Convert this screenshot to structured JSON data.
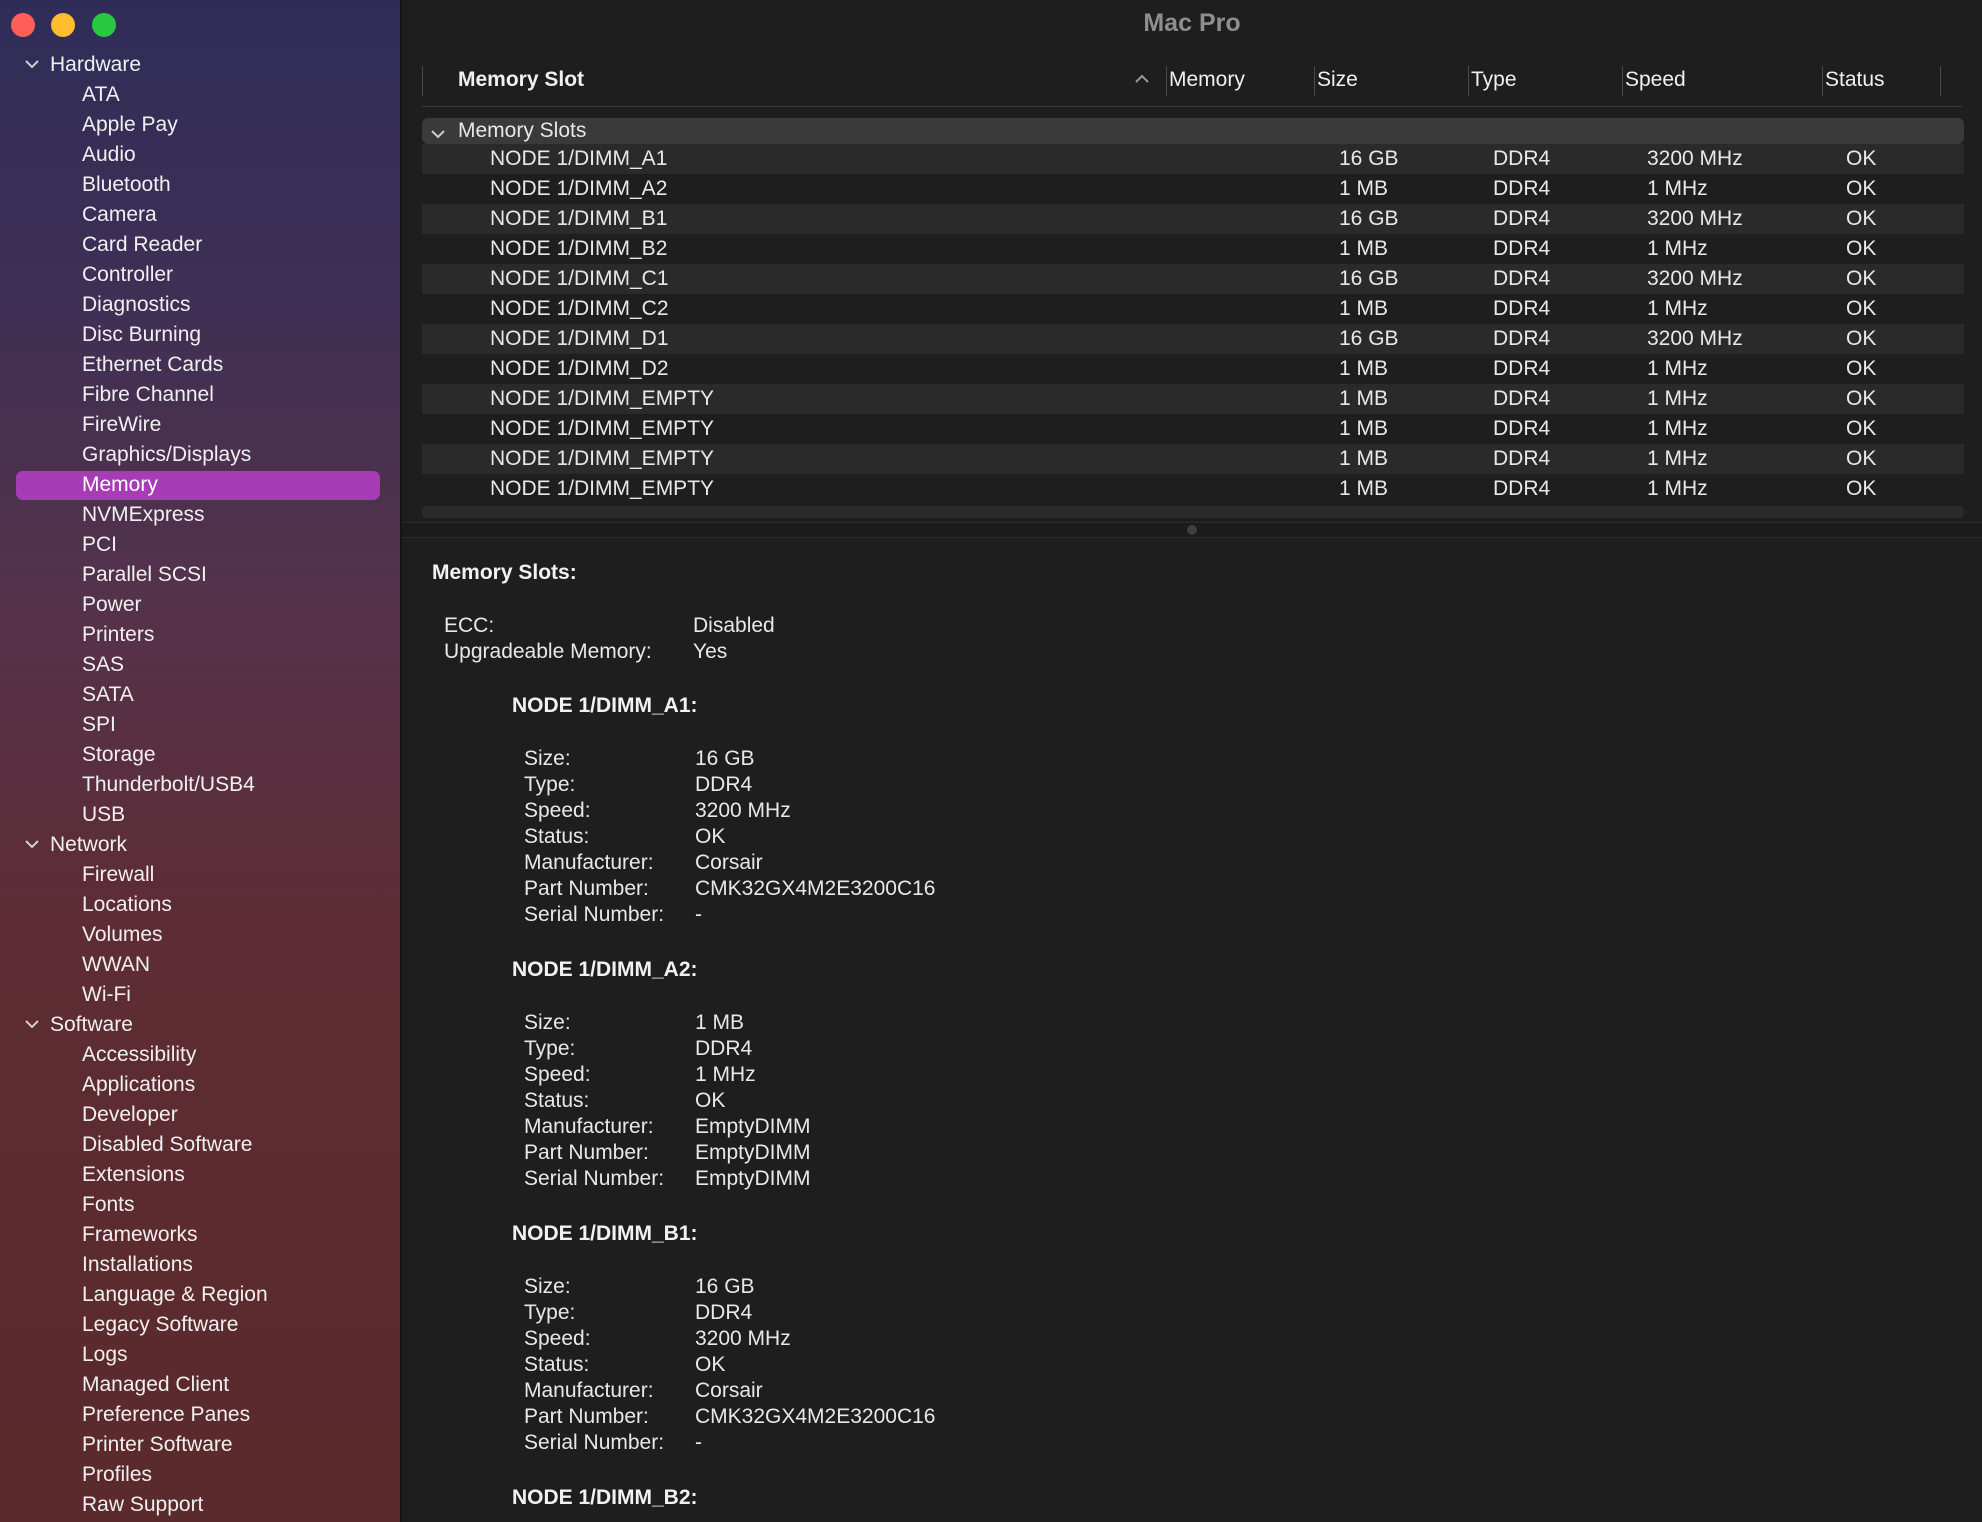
{
  "window": {
    "title": "Mac Pro"
  },
  "sidebar": {
    "groups": [
      {
        "label": "Hardware",
        "items": [
          "ATA",
          "Apple Pay",
          "Audio",
          "Bluetooth",
          "Camera",
          "Card Reader",
          "Controller",
          "Diagnostics",
          "Disc Burning",
          "Ethernet Cards",
          "Fibre Channel",
          "FireWire",
          "Graphics/Displays",
          "Memory",
          "NVMExpress",
          "PCI",
          "Parallel SCSI",
          "Power",
          "Printers",
          "SAS",
          "SATA",
          "SPI",
          "Storage",
          "Thunderbolt/USB4",
          "USB"
        ]
      },
      {
        "label": "Network",
        "items": [
          "Firewall",
          "Locations",
          "Volumes",
          "WWAN",
          "Wi-Fi"
        ]
      },
      {
        "label": "Software",
        "items": [
          "Accessibility",
          "Applications",
          "Developer",
          "Disabled Software",
          "Extensions",
          "Fonts",
          "Frameworks",
          "Installations",
          "Language & Region",
          "Legacy Software",
          "Logs",
          "Managed Client",
          "Preference Panes",
          "Printer Software",
          "Profiles",
          "Raw Support"
        ]
      }
    ],
    "selected": "Memory"
  },
  "table": {
    "columns": [
      "Memory Slot",
      "Memory",
      "Size",
      "Type",
      "Speed",
      "Status"
    ],
    "group_label": "Memory Slots",
    "rows": [
      {
        "slot": "NODE 1/DIMM_A1",
        "size": "16 GB",
        "type": "DDR4",
        "speed": "3200 MHz",
        "status": "OK"
      },
      {
        "slot": "NODE 1/DIMM_A2",
        "size": "1 MB",
        "type": "DDR4",
        "speed": "1 MHz",
        "status": "OK"
      },
      {
        "slot": "NODE 1/DIMM_B1",
        "size": "16 GB",
        "type": "DDR4",
        "speed": "3200 MHz",
        "status": "OK"
      },
      {
        "slot": "NODE 1/DIMM_B2",
        "size": "1 MB",
        "type": "DDR4",
        "speed": "1 MHz",
        "status": "OK"
      },
      {
        "slot": "NODE 1/DIMM_C1",
        "size": "16 GB",
        "type": "DDR4",
        "speed": "3200 MHz",
        "status": "OK"
      },
      {
        "slot": "NODE 1/DIMM_C2",
        "size": "1 MB",
        "type": "DDR4",
        "speed": "1 MHz",
        "status": "OK"
      },
      {
        "slot": "NODE 1/DIMM_D1",
        "size": "16 GB",
        "type": "DDR4",
        "speed": "3200 MHz",
        "status": "OK"
      },
      {
        "slot": "NODE 1/DIMM_D2",
        "size": "1 MB",
        "type": "DDR4",
        "speed": "1 MHz",
        "status": "OK"
      },
      {
        "slot": "NODE 1/DIMM_EMPTY",
        "size": "1 MB",
        "type": "DDR4",
        "speed": "1 MHz",
        "status": "OK"
      },
      {
        "slot": "NODE 1/DIMM_EMPTY",
        "size": "1 MB",
        "type": "DDR4",
        "speed": "1 MHz",
        "status": "OK"
      },
      {
        "slot": "NODE 1/DIMM_EMPTY",
        "size": "1 MB",
        "type": "DDR4",
        "speed": "1 MHz",
        "status": "OK"
      },
      {
        "slot": "NODE 1/DIMM_EMPTY",
        "size": "1 MB",
        "type": "DDR4",
        "speed": "1 MHz",
        "status": "OK"
      }
    ]
  },
  "detail": {
    "heading": "Memory Slots:",
    "summary": [
      {
        "label": "ECC:",
        "value": "Disabled"
      },
      {
        "label": "Upgradeable Memory:",
        "value": "Yes"
      }
    ],
    "slots": [
      {
        "title": "NODE 1/DIMM_A1:",
        "fields": [
          {
            "label": "Size:",
            "value": "16 GB"
          },
          {
            "label": "Type:",
            "value": "DDR4"
          },
          {
            "label": "Speed:",
            "value": "3200 MHz"
          },
          {
            "label": "Status:",
            "value": "OK"
          },
          {
            "label": "Manufacturer:",
            "value": "Corsair"
          },
          {
            "label": "Part Number:",
            "value": "CMK32GX4M2E3200C16"
          },
          {
            "label": "Serial Number:",
            "value": "-"
          }
        ]
      },
      {
        "title": "NODE 1/DIMM_A2:",
        "fields": [
          {
            "label": "Size:",
            "value": "1 MB"
          },
          {
            "label": "Type:",
            "value": "DDR4"
          },
          {
            "label": "Speed:",
            "value": "1 MHz"
          },
          {
            "label": "Status:",
            "value": "OK"
          },
          {
            "label": "Manufacturer:",
            "value": "EmptyDIMM"
          },
          {
            "label": "Part Number:",
            "value": "EmptyDIMM"
          },
          {
            "label": "Serial Number:",
            "value": "EmptyDIMM"
          }
        ]
      },
      {
        "title": "NODE 1/DIMM_B1:",
        "fields": [
          {
            "label": "Size:",
            "value": "16 GB"
          },
          {
            "label": "Type:",
            "value": "DDR4"
          },
          {
            "label": "Speed:",
            "value": "3200 MHz"
          },
          {
            "label": "Status:",
            "value": "OK"
          },
          {
            "label": "Manufacturer:",
            "value": "Corsair"
          },
          {
            "label": "Part Number:",
            "value": "CMK32GX4M2E3200C16"
          },
          {
            "label": "Serial Number:",
            "value": "-"
          }
        ]
      },
      {
        "title": "NODE 1/DIMM_B2:",
        "fields": []
      }
    ]
  },
  "icons": {
    "chevron": "chevron-down-icon",
    "sort": "sort-ascending-icon"
  },
  "colors": {
    "selection": "#a83cb6",
    "close": "#ff5f57",
    "minimize": "#febc2e",
    "maximize": "#28c840"
  }
}
